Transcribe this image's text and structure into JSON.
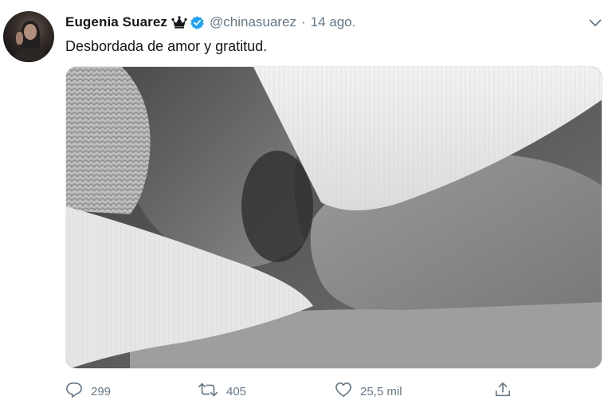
{
  "tweet": {
    "author_name": "Eugenia Suarez",
    "crown_emoji": "crown-icon",
    "verified": "verified-icon",
    "handle": "@chinasuarez",
    "separator": "·",
    "time": "14 ago.",
    "text": "Desbordada de amor y gratitud.",
    "actions": {
      "reply_count": "299",
      "retweet_count": "405",
      "like_count": "25,5 mil"
    }
  },
  "colors": {
    "verified_blue": "#1da1f2",
    "secondary_text": "#657786",
    "primary_text": "#14171a"
  }
}
